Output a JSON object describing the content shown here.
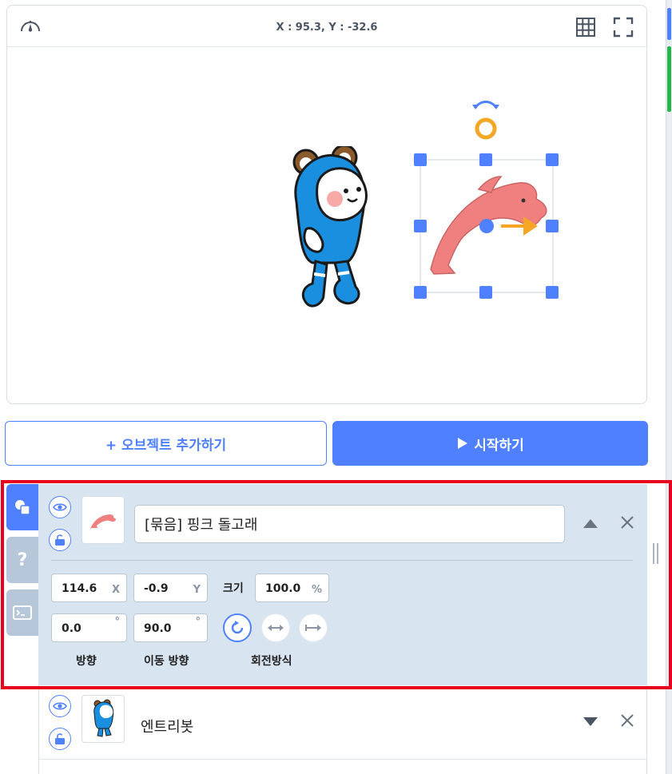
{
  "stage": {
    "coordinates": "X : 95.3, Y : -32.6",
    "icons": {
      "speed": "speedometer-icon",
      "grid": "grid-icon",
      "fullscreen": "fullscreen-icon"
    }
  },
  "buttons": {
    "add_object": "+ 오브젝트 추가하기",
    "start": "시작하기"
  },
  "side_tabs": [
    "object-tab",
    "help-tab",
    "console-tab"
  ],
  "objects": [
    {
      "name": "[묶음] 핑크 돌고래",
      "x": "114.6",
      "x_unit": "X",
      "y": "-0.9",
      "y_unit": "Y",
      "size_label": "크기",
      "size": "100.0",
      "size_unit": "%",
      "direction": "0.0",
      "direction_unit": "°",
      "move_direction": "90.0",
      "move_direction_unit": "°",
      "direction_label": "방향",
      "move_direction_label": "이동 방향",
      "rotation_label": "회전방식"
    },
    {
      "name": "엔트리봇"
    }
  ],
  "colors": {
    "accent": "#4f80ff",
    "panel": "#d9e4f1",
    "highlight": "#e8001c",
    "handle_orange": "#f5a623",
    "dolphin": "#f08080"
  }
}
